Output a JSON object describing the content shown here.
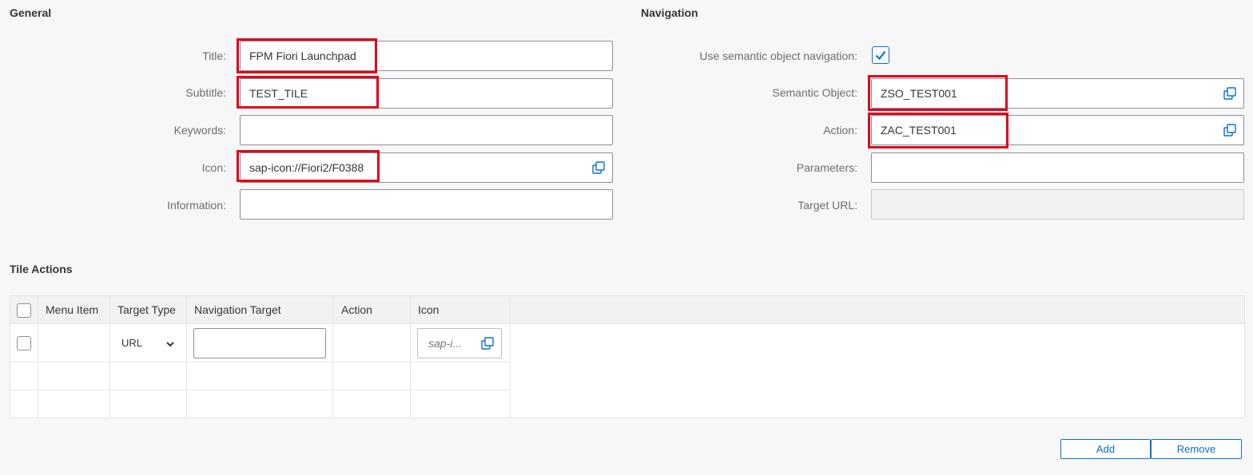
{
  "general": {
    "title": "General",
    "fields": {
      "title_label": "Title:",
      "title_value": "FPM Fiori Launchpad",
      "subtitle_label": "Subtitle:",
      "subtitle_value": "TEST_TILE",
      "keywords_label": "Keywords:",
      "keywords_value": "",
      "icon_label": "Icon:",
      "icon_value": "sap-icon://Fiori2/F0388",
      "information_label": "Information:",
      "information_value": ""
    }
  },
  "navigation": {
    "title": "Navigation",
    "use_semantic_label": "Use semantic object navigation:",
    "use_semantic_checked": true,
    "semantic_object_label": "Semantic Object:",
    "semantic_object_value": "ZSO_TEST001",
    "action_label": "Action:",
    "action_value": "ZAC_TEST001",
    "parameters_label": "Parameters:",
    "parameters_value": "",
    "target_url_label": "Target URL:",
    "target_url_value": ""
  },
  "tile_actions": {
    "title": "Tile Actions",
    "columns": [
      "Menu Item",
      "Target Type",
      "Navigation Target",
      "Action",
      "Icon"
    ],
    "rows": [
      {
        "menu_item": "",
        "target_type": "URL",
        "navigation_target": "",
        "action": "",
        "icon_placeholder": "sap-i..."
      }
    ],
    "add_label": "Add",
    "remove_label": "Remove"
  },
  "colors": {
    "accent": "#0a6ed1",
    "highlight": "#e0001b",
    "background": "#f7f7f7"
  },
  "icons": [
    "value-help-icon",
    "checkmark-icon",
    "chevron-down-icon"
  ]
}
